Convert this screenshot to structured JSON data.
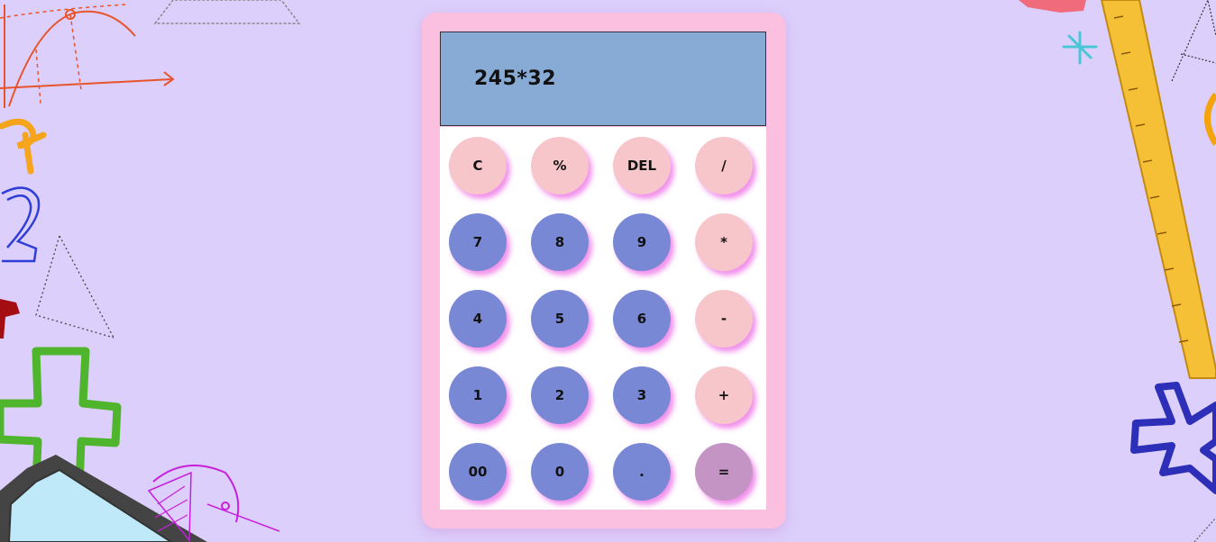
{
  "display": {
    "expression": "245*32"
  },
  "keys": [
    {
      "label": "C",
      "type": "op"
    },
    {
      "label": "%",
      "type": "op"
    },
    {
      "label": "DEL",
      "type": "op"
    },
    {
      "label": "/",
      "type": "op"
    },
    {
      "label": "7",
      "type": "num"
    },
    {
      "label": "8",
      "type": "num"
    },
    {
      "label": "9",
      "type": "num"
    },
    {
      "label": "*",
      "type": "op"
    },
    {
      "label": "4",
      "type": "num"
    },
    {
      "label": "5",
      "type": "num"
    },
    {
      "label": "6",
      "type": "num"
    },
    {
      "label": "-",
      "type": "op"
    },
    {
      "label": "1",
      "type": "num"
    },
    {
      "label": "2",
      "type": "num"
    },
    {
      "label": "3",
      "type": "num"
    },
    {
      "label": "+",
      "type": "op"
    },
    {
      "label": "00",
      "type": "num"
    },
    {
      "label": "0",
      "type": "num"
    },
    {
      "label": ".",
      "type": "num"
    },
    {
      "label": "=",
      "type": "eq"
    }
  ],
  "colors": {
    "background": "#dccffc",
    "calculator_body": "#fbbfe0",
    "screen": "#88abd5",
    "operator_key": "#f6c6cb",
    "number_key": "#7888d4",
    "equals_key": "#c394c4",
    "key_shadow": "#ee6ee6"
  }
}
